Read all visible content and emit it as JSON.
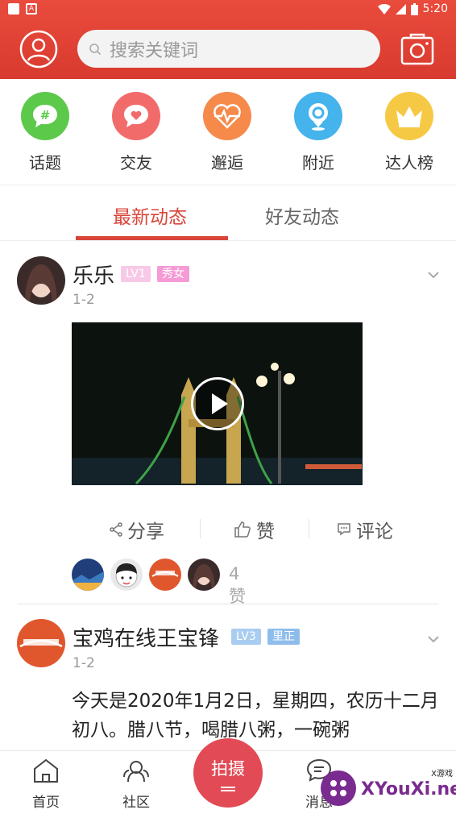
{
  "status_bar": {
    "time": "5:20"
  },
  "header": {
    "search_placeholder": "搜索关键词"
  },
  "categories": [
    {
      "label": "话题",
      "color": "#5cc94b",
      "icon": "hashtag-bubble-icon"
    },
    {
      "label": "交友",
      "color": "#f26b6b",
      "icon": "heart-bubble-icon"
    },
    {
      "label": "邂逅",
      "color": "#f58a4b",
      "icon": "heartbeat-icon"
    },
    {
      "label": "附近",
      "color": "#45b3ec",
      "icon": "location-pin-icon"
    },
    {
      "label": "达人榜",
      "color": "#f6c945",
      "icon": "crown-icon"
    }
  ],
  "tabs": [
    {
      "label": "最新动态",
      "active": true
    },
    {
      "label": "好友动态",
      "active": false
    }
  ],
  "posts": [
    {
      "username": "乐乐",
      "level": "LV1",
      "tag": "秀女",
      "time": "1-2",
      "actions": {
        "share": "分享",
        "like": "赞",
        "comment": "评论"
      },
      "like_count": "4赞"
    },
    {
      "username": "宝鸡在线王宝锋",
      "level": "LV3",
      "tag": "里正",
      "time": "1-2",
      "text": "今天是2020年1月2日，星期四，农历十二月初八。腊八节，喝腊八粥，一碗粥"
    }
  ],
  "bottom_nav": [
    {
      "label": "首页"
    },
    {
      "label": "社区"
    },
    {
      "label": "拍摄"
    },
    {
      "label": "消息"
    }
  ],
  "watermark": {
    "brand": "XYouXi.net",
    "small": "X游戏"
  }
}
